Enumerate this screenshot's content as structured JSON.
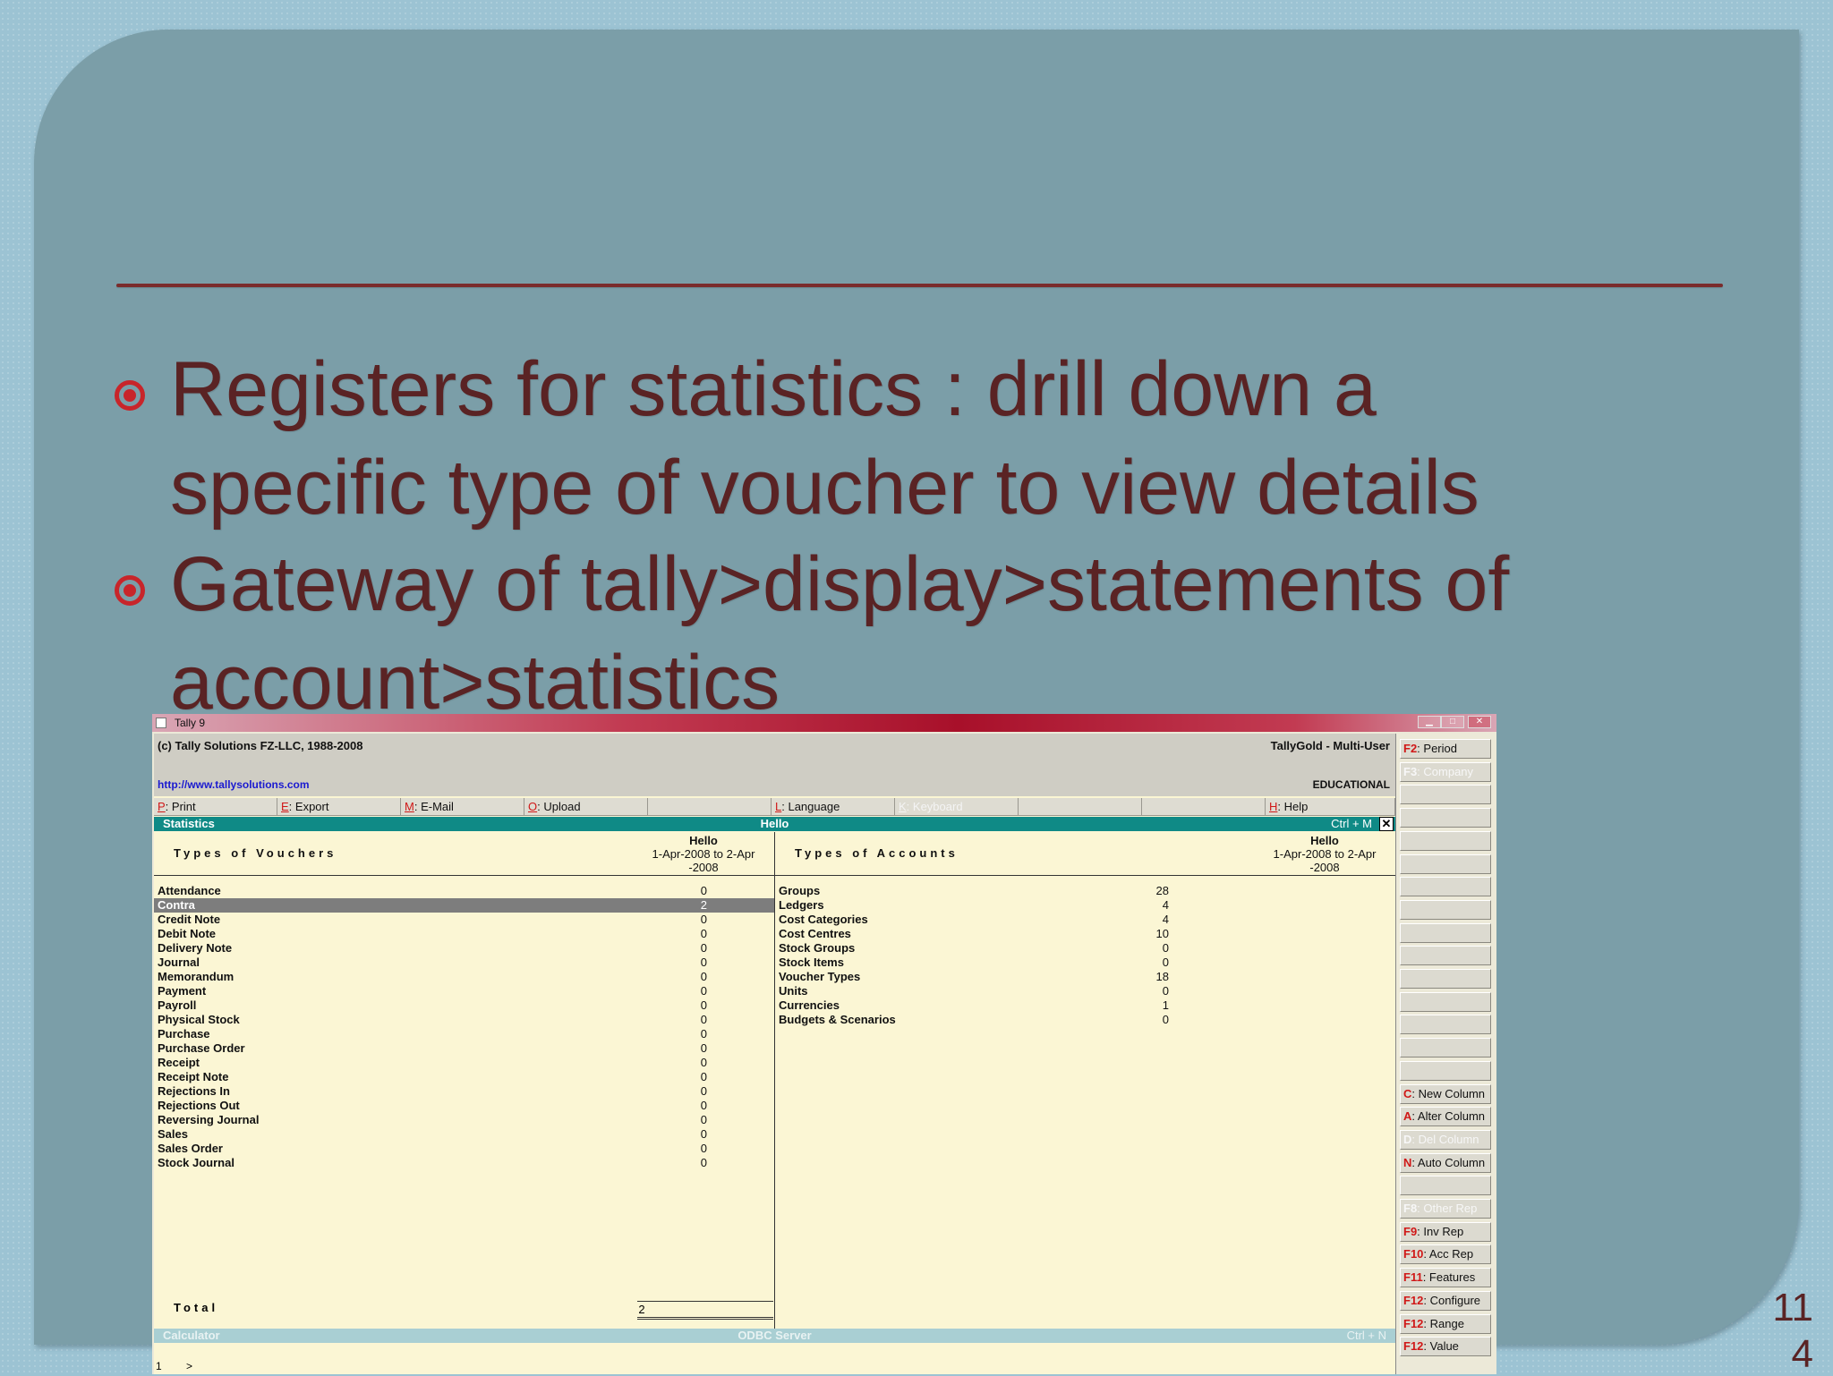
{
  "slide": {
    "bullets": [
      {
        "line1": "Registers for statistics : drill down a",
        "line2": "specific type of voucher to view details"
      },
      {
        "line1": "Gateway of tally>display>statements of",
        "line2": "account>statistics"
      }
    ],
    "page_number_line1": "11",
    "page_number_line2": "4"
  },
  "window": {
    "title": "Tally 9",
    "minimize": "▁",
    "maximize": "□",
    "close": "✕"
  },
  "header": {
    "copyright": "(c) Tally Solutions FZ-LLC, 1988-2008",
    "edition": "TallyGold - Multi-User",
    "website": "http://www.tallysolutions.com",
    "license": "EDUCATIONAL"
  },
  "button_bar": [
    {
      "key": "P",
      "label": ": Print",
      "enabled": true
    },
    {
      "key": "E",
      "label": ": Export",
      "enabled": true
    },
    {
      "key": "M",
      "label": ": E-Mail",
      "enabled": true
    },
    {
      "key": "O",
      "label": ": Upload",
      "enabled": true
    },
    {
      "key": "",
      "label": "",
      "enabled": true
    },
    {
      "key": "L",
      "label": ": Language",
      "enabled": true
    },
    {
      "key": "K",
      "label": ": Keyboard",
      "enabled": false
    },
    {
      "key": "",
      "label": "",
      "enabled": true
    },
    {
      "key": "",
      "label": "",
      "enabled": true
    },
    {
      "key": "H",
      "label": ": Help",
      "enabled": true
    }
  ],
  "report_bar": {
    "left": "Statistics",
    "center": "Hello",
    "shortcut": "Ctrl + M",
    "close": "✕"
  },
  "vouchers": {
    "heading": "Types of Vouchers",
    "company": "Hello",
    "period_line1": "1-Apr-2008 to 2-Apr",
    "period_line2": "-2008",
    "rows": [
      {
        "name": "Attendance",
        "value": "0"
      },
      {
        "name": "Contra",
        "value": "2",
        "selected": true
      },
      {
        "name": "Credit Note",
        "value": "0"
      },
      {
        "name": "Debit Note",
        "value": "0"
      },
      {
        "name": "Delivery Note",
        "value": "0"
      },
      {
        "name": "Journal",
        "value": "0"
      },
      {
        "name": "Memorandum",
        "value": "0"
      },
      {
        "name": "Payment",
        "value": "0"
      },
      {
        "name": "Payroll",
        "value": "0"
      },
      {
        "name": "Physical Stock",
        "value": "0"
      },
      {
        "name": "Purchase",
        "value": "0"
      },
      {
        "name": "Purchase Order",
        "value": "0"
      },
      {
        "name": "Receipt",
        "value": "0"
      },
      {
        "name": "Receipt Note",
        "value": "0"
      },
      {
        "name": "Rejections In",
        "value": "0"
      },
      {
        "name": "Rejections Out",
        "value": "0"
      },
      {
        "name": "Reversing Journal",
        "value": "0"
      },
      {
        "name": "Sales",
        "value": "0"
      },
      {
        "name": "Sales Order",
        "value": "0"
      },
      {
        "name": "Stock Journal",
        "value": "0"
      }
    ],
    "total_label": "Total",
    "total_value": "2"
  },
  "accounts": {
    "heading": "Types of Accounts",
    "company": "Hello",
    "period_line1": "1-Apr-2008 to 2-Apr",
    "period_line2": "-2008",
    "rows": [
      {
        "name": "Groups",
        "value": "28"
      },
      {
        "name": "Ledgers",
        "value": "4"
      },
      {
        "name": "Cost Categories",
        "value": "4"
      },
      {
        "name": "Cost Centres",
        "value": "10"
      },
      {
        "name": "Stock Groups",
        "value": "0"
      },
      {
        "name": "Stock Items",
        "value": "0"
      },
      {
        "name": "Voucher Types",
        "value": "18"
      },
      {
        "name": "Units",
        "value": "0"
      },
      {
        "name": "Currencies",
        "value": "1"
      },
      {
        "name": "Budgets & Scenarios",
        "value": "0"
      }
    ]
  },
  "calculator": {
    "label": "Calculator",
    "center": "ODBC Server",
    "shortcut": "Ctrl + N",
    "line_number": "1",
    "prompt": ">"
  },
  "side_buttons": [
    {
      "key": "F2",
      "label": ": Period",
      "enabled": true,
      "slot": 0
    },
    {
      "key": "F3",
      "label": ": Company",
      "enabled": false,
      "slot": 1
    },
    {
      "key": "C",
      "label": ": New Column",
      "enabled": true,
      "slot": 15
    },
    {
      "key": "A",
      "label": ": Alter Column",
      "enabled": true,
      "slot": 16
    },
    {
      "key": "D",
      "label": ": Del Column",
      "enabled": false,
      "slot": 17
    },
    {
      "key": "N",
      "label": ": Auto Column",
      "enabled": true,
      "slot": 18
    },
    {
      "key": "F8",
      "label": ": Other Rep",
      "enabled": false,
      "slot": 20
    },
    {
      "key": "F9",
      "label": ": Inv Rep",
      "enabled": true,
      "slot": 21
    },
    {
      "key": "F10",
      "label": ": Acc Rep",
      "enabled": true,
      "slot": 22
    },
    {
      "key": "F11",
      "label": ": Features",
      "enabled": true,
      "slot": 23
    },
    {
      "key": "F12",
      "label": ": Configure",
      "enabled": true,
      "slot": 24
    },
    {
      "key": "F12",
      "label": ": Range",
      "enabled": true,
      "slot": 25
    },
    {
      "key": "F12",
      "label": ": Value",
      "enabled": true,
      "slot": 26
    }
  ],
  "colors": {
    "background": "#9cc3d3",
    "panel": "#7b9ea8",
    "text": "#5a2324",
    "bullet": "#c8252a",
    "report_bar": "#0f8a86",
    "report_body": "#fbf6d4"
  }
}
